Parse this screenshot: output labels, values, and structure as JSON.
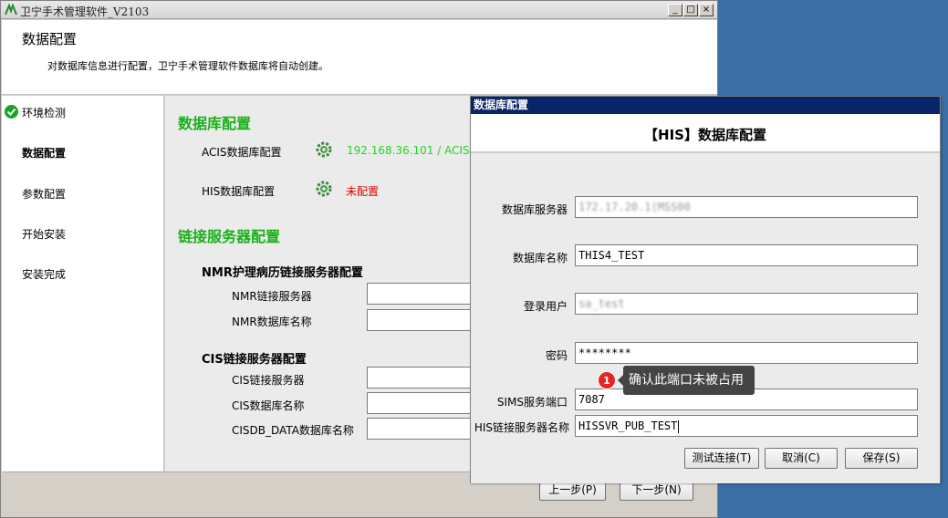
{
  "window": {
    "title": "卫宁手术管理软件_V2103",
    "minimize": "_",
    "maximize": "□",
    "close": "×"
  },
  "header": {
    "title": "数据配置",
    "subtitle": "对数据库信息进行配置，卫宁手术管理软件数据库将自动创建。"
  },
  "sidebar": {
    "items": [
      {
        "label": "环境检测",
        "done": true
      },
      {
        "label": "数据配置",
        "active": true
      },
      {
        "label": "参数配置"
      },
      {
        "label": "开始安装"
      },
      {
        "label": "安装完成"
      }
    ]
  },
  "content": {
    "db_section_title": "数据库配置",
    "acis_label": "ACIS数据库配置",
    "acis_value": "192.168.36.101 / ACIS",
    "his_label": "HIS数据库配置",
    "his_value": "未配置",
    "link_section_title": "链接服务器配置",
    "nmr_title": "NMR护理病历链接服务器配置",
    "nmr_server_label": "NMR链接服务器",
    "nmr_db_label": "NMR数据库名称",
    "cis_title": "CIS链接服务器配置",
    "cis_server_label": "CIS链接服务器",
    "cis_db_label": "CIS数据库名称",
    "cisdb_data_label": "CISDB_DATA数据库名称"
  },
  "footer": {
    "prev": "上一步(P)",
    "next": "下一步(N)"
  },
  "dialog": {
    "title": "数据库配置",
    "heading": "【HIS】数据库配置",
    "fields": {
      "server_label": "数据库服务器",
      "server_value": "172.17.20.1(MSS00",
      "dbname_label": "数据库名称",
      "dbname_value": "THIS4_TEST",
      "user_label": "登录用户",
      "user_value": "sa_test",
      "password_label": "密码",
      "password_value": "********",
      "sims_port_label": "SIMS服务端口",
      "sims_port_value": "7087",
      "his_link_label": "HIS链接服务器名称",
      "his_link_value": "HISSVR_PUB_TEST"
    },
    "buttons": {
      "test": "测试连接(T)",
      "cancel": "取消(C)",
      "save": "保存(S)"
    }
  },
  "tooltip": {
    "badge": "1",
    "text": "确认此端口未被占用"
  },
  "colors": {
    "section_green": "#19b019",
    "acis_green": "#2bd02b",
    "unconfigured_red": "#e00000",
    "dialog_title_bar": "#0a246a",
    "desktop": "#3a6ea5"
  }
}
